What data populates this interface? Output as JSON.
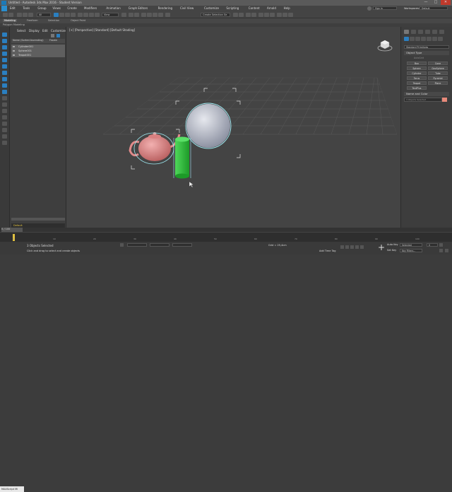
{
  "window": {
    "title": "Untitled - Autodesk 3ds Max 2016 - Student Version",
    "minimize": "—",
    "maximize": "□",
    "close": "✕"
  },
  "menu": [
    "Edit",
    "Tools",
    "Group",
    "Views",
    "Create",
    "Modifiers",
    "Animation",
    "Graph Editors",
    "Rendering",
    "Civil View",
    "Customize",
    "Scripting",
    "Content",
    "Arnold",
    "Help"
  ],
  "signin": "Sign In",
  "workspaces_label": "Workspaces:",
  "workspaces_value": "Default",
  "toolbar": {
    "selection_filter": "All",
    "view": "View",
    "selection_set": "Create Selection Se"
  },
  "ribbon": {
    "tabs": [
      "Modeling",
      "Freeform",
      "Selection",
      "Object Paint"
    ],
    "subtitle": "Polygon Modeling"
  },
  "scene_explorer": {
    "tabs": [
      "Select",
      "Display",
      "Edit",
      "Customize"
    ],
    "header": "Name (Sorted Ascending)",
    "header_frozen": "Frozen",
    "objects": [
      "Cylinder001",
      "Sphere001",
      "Teapot001"
    ],
    "layer": "Default"
  },
  "viewport": {
    "label": "[+] [Perspective] [Standard] [Default Shading]"
  },
  "command_panel": {
    "category": "Standard Primitives",
    "object_type_title": "Object Type",
    "autogrid": "AutoGrid",
    "buttons": [
      "Box",
      "Cone",
      "Sphere",
      "GeoSphere",
      "Cylinder",
      "Tube",
      "Torus",
      "Pyramid",
      "Teapot",
      "Plane",
      "TextPlus"
    ],
    "name_color_title": "Name and Color",
    "name_placeholder": "3 Objects Selected"
  },
  "timeline": {
    "range": "0 / 100",
    "frame_ticks": [
      "0",
      "10",
      "20",
      "30",
      "40",
      "50",
      "60",
      "70",
      "80",
      "90",
      "100"
    ]
  },
  "status": {
    "maxscript": "MAXScript Mi",
    "selected": "3 Objects Selected",
    "hint": "Click and drag to select and create objects",
    "grid": "Grid = 25,4cm",
    "add_time_tag": "Add Time Tag",
    "auto_key": "Auto Key",
    "set_key": "Set Key",
    "key_filters": "Key Filters...",
    "selected_dropdown": "Selected",
    "frame": "0"
  },
  "colors": {
    "teapot": "#e08a8a",
    "sphere": "#b8bcc8",
    "cylinder": "#2dbe3a",
    "selection": "#9de8f0",
    "accent": "#2b7fc0"
  }
}
